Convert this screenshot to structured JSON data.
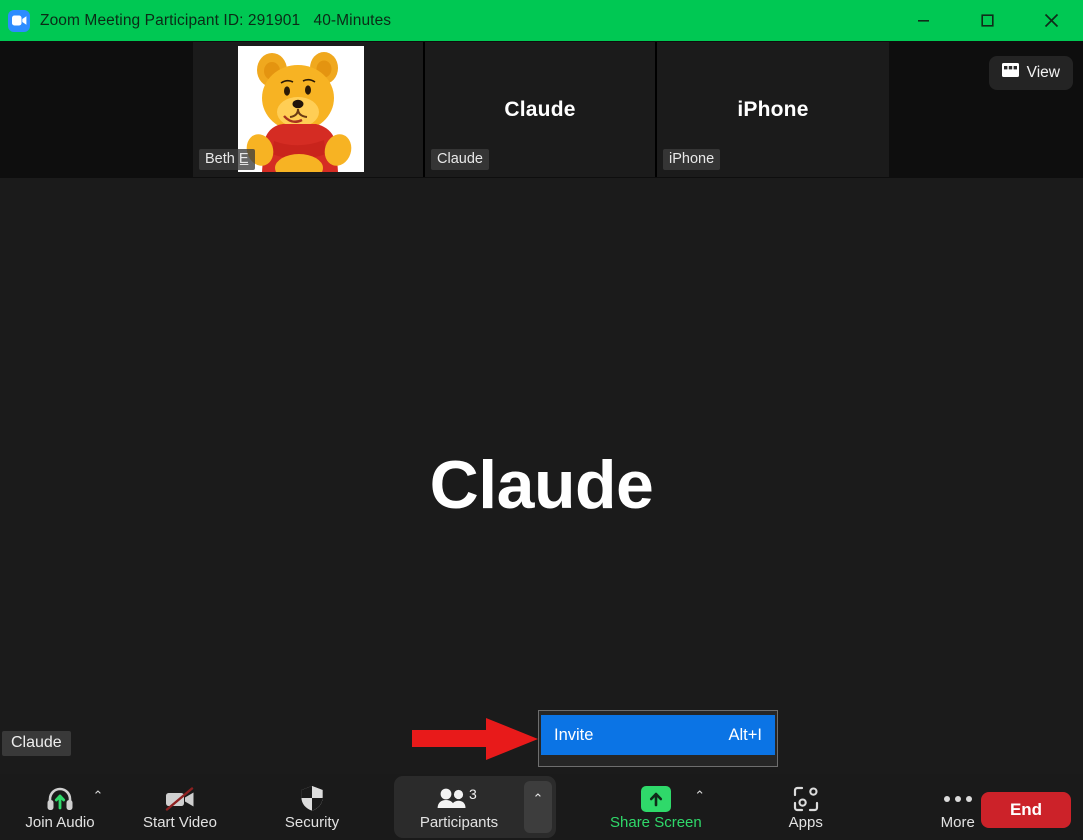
{
  "window": {
    "app_icon": "zoom-camera-icon",
    "title": "Zoom Meeting Participant ID: 291901   40-Minutes",
    "minimize_label": "–",
    "maximize_label": "□",
    "close_label": "✕",
    "titlebar_color": "#00c853"
  },
  "thumbnails": [
    {
      "display_name": "",
      "label": "Beth E̲",
      "avatar": "winnie-the-pooh-avatar"
    },
    {
      "display_name": "Claude",
      "label": "Claude",
      "avatar": ""
    },
    {
      "display_name": "iPhone",
      "label": "iPhone",
      "avatar": ""
    }
  ],
  "view_button": {
    "label": "View",
    "icon": "grid-view-icon"
  },
  "encryption_badge": {
    "icon": "shield-check-icon",
    "color": "#2ecc5b"
  },
  "stage": {
    "active_speaker_name": "Claude",
    "name_label": "Claude"
  },
  "context_menu": {
    "items": [
      {
        "label": "Invite",
        "accelerator": "Alt+I",
        "highlighted": true
      }
    ],
    "highlight_color": "#0b74e5"
  },
  "annotation": {
    "arrow": "red-arrow-pointing-right",
    "color": "#e81a1a"
  },
  "toolbar": {
    "join_audio": {
      "label": "Join Audio",
      "icon": "headset-audio-icon",
      "has_caret": true
    },
    "start_video": {
      "label": "Start Video",
      "icon": "camera-off-icon",
      "has_caret": false
    },
    "security": {
      "label": "Security",
      "icon": "shield-icon",
      "has_caret": false
    },
    "participants": {
      "label": "Participants",
      "icon": "participants-icon",
      "count": "3",
      "has_caret": true,
      "active": true
    },
    "share_screen": {
      "label": "Share Screen",
      "icon": "share-screen-up-arrow-icon",
      "has_caret": true,
      "color": "#2fd96a"
    },
    "apps": {
      "label": "Apps",
      "icon": "apps-icon",
      "has_caret": false
    },
    "more": {
      "label": "More",
      "icon": "more-dots-icon",
      "has_caret": false
    },
    "end": {
      "label": "End",
      "color": "#cc2229"
    },
    "caret_glyph": "⌃"
  }
}
